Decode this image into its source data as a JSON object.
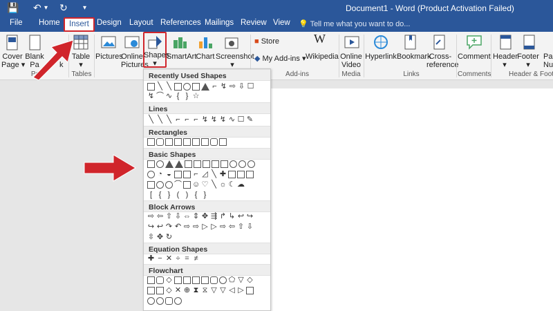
{
  "window": {
    "title": "Document1 - Word (Product Activation Failed)"
  },
  "quick_access": {
    "save": "💾",
    "undo": "↶",
    "undo_caret": "▾",
    "redo": "↻",
    "more": "▾"
  },
  "tabs": [
    "File",
    "Home",
    "Insert",
    "Design",
    "Layout",
    "References",
    "Mailings",
    "Review",
    "View"
  ],
  "tell_me": "Tell me what you want to do...",
  "ribbon": {
    "cover_page": "Cover",
    "cover_page2": "Page ▾",
    "blank_page": "Blank",
    "blank_page2": "Pa",
    "page_break": "k",
    "pages_group": "Pa",
    "table": "Table",
    "table_caret": "▾",
    "tables_group": "Tables",
    "pictures": "Pictures",
    "online_pictures": "Online",
    "online_pictures2": "Pictures",
    "shapes": "Shapes",
    "shapes_caret": "▾",
    "smartart": "SmartArt",
    "chart": "Chart",
    "screenshot": "Screenshot",
    "screenshot_caret": "▾",
    "store": "Store",
    "my_addins": "My Add-ins",
    "my_addins_caret": "▾",
    "wikipedia": "Wikipedia",
    "addins_group": "Add-ins",
    "online_video": "Online",
    "online_video2": "Video",
    "media_group": "Media",
    "hyperlink": "Hyperlink",
    "bookmark": "Bookmark",
    "cross_reference": "Cross-",
    "cross_reference2": "reference",
    "links_group": "Links",
    "comment": "Comment",
    "comments_group": "Comments",
    "header": "Header",
    "header_caret": "▾",
    "footer": "Footer",
    "footer_caret": "▾",
    "page_number": "Pa",
    "page_number2": "Num",
    "header_footer_group": "Header & Footer"
  },
  "shapes_menu": {
    "sections": [
      "Recently Used Shapes",
      "Lines",
      "Rectangles",
      "Basic Shapes",
      "Block Arrows",
      "Equation Shapes",
      "Flowchart"
    ]
  },
  "colors": {
    "accent": "#2b579a",
    "highlight": "#d0252b"
  }
}
